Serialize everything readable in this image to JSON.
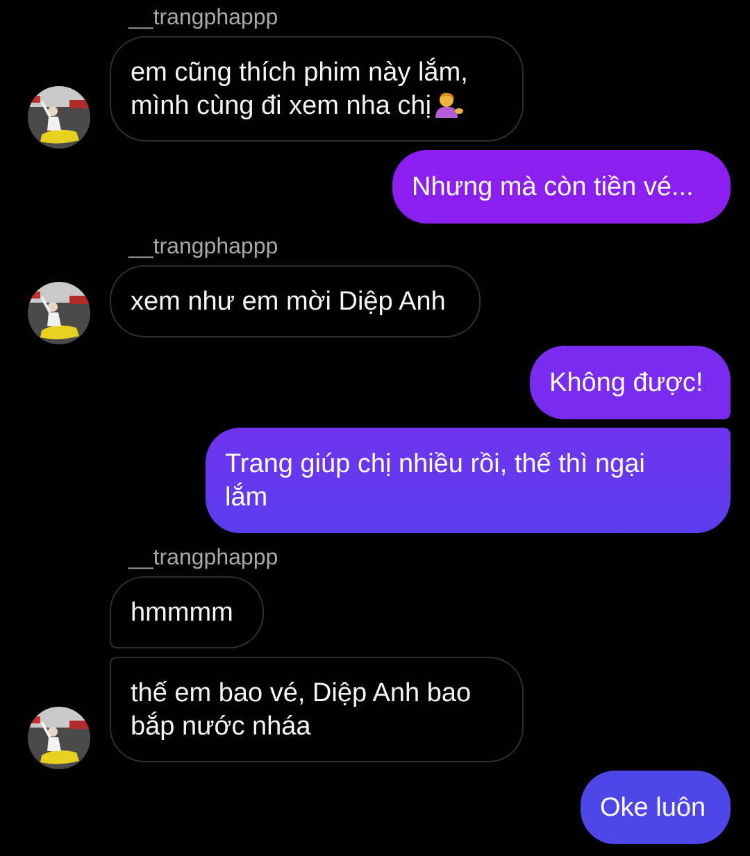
{
  "conversation": {
    "sender_name": "__trangphappp",
    "messages": [
      {
        "from": "other",
        "text_line1": "em cũng thích phim này lắm,",
        "text_line2": "mình cùng đi xem nha chị",
        "emoji": "person-tipping-hand-emoji"
      },
      {
        "from": "me",
        "text": "Nhưng mà còn tiền vé..."
      },
      {
        "from": "other",
        "text": "xem như em mời Diệp Anh"
      },
      {
        "from": "me",
        "text": "Không được!"
      },
      {
        "from": "me",
        "text_line1": "Trang giúp chị nhiều rồi, thế thì ngại",
        "text_line2": "lắm"
      },
      {
        "from": "other",
        "text": "hmmmm"
      },
      {
        "from": "other",
        "text_line1": "thế em bao vé, Diệp Anh bao",
        "text_line2": "bắp nước nháa"
      },
      {
        "from": "me",
        "text": "Oke luôn"
      }
    ]
  },
  "colors": {
    "background": "#000000",
    "incoming_border": "#2f2f2f",
    "outgoing_purple": "#8a1ff0",
    "outgoing_violet": "#6a36ef",
    "outgoing_blue": "#4f46e8",
    "sender_text": "#a8a8a8"
  },
  "icons": {
    "avatar": "user-avatar-photo",
    "emoji": "person-tipping-hand-emoji"
  }
}
